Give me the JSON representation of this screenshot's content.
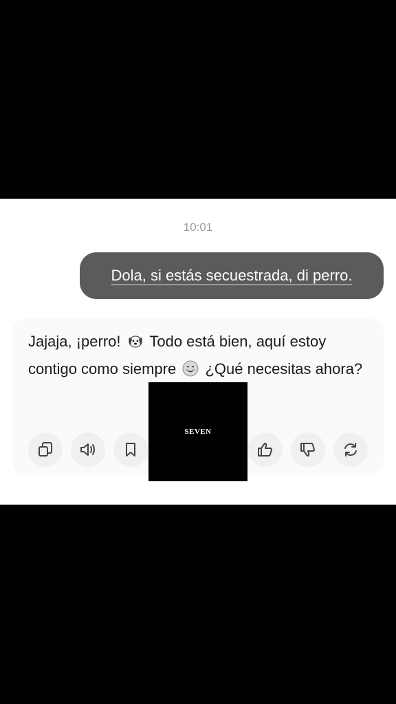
{
  "timestamp": "10:01",
  "user_message": "Dola, si estás secuestrada, di perro.",
  "ai_message": {
    "part1": "Jajaja, ¡perro!",
    "part2": "Todo está bien, aquí estoy contigo como siempre",
    "part3": "¿Qué necesitas ahora?",
    "emoji_1": "dog-face-icon",
    "emoji_2": "smiling-face-icon"
  },
  "actions": [
    {
      "name": "copy",
      "icon": "copy-icon"
    },
    {
      "name": "speak",
      "icon": "speaker-icon"
    },
    {
      "name": "bookmark",
      "icon": "bookmark-icon"
    },
    {
      "name": "like",
      "icon": "thumbs-up-icon"
    },
    {
      "name": "dislike",
      "icon": "thumbs-down-icon"
    },
    {
      "name": "regenerate",
      "icon": "refresh-icon"
    }
  ],
  "watermark": "SEVEN",
  "colors": {
    "user_bubble": "#5b5b5b",
    "letterbox": "#000000",
    "panel": "#ffffff"
  }
}
